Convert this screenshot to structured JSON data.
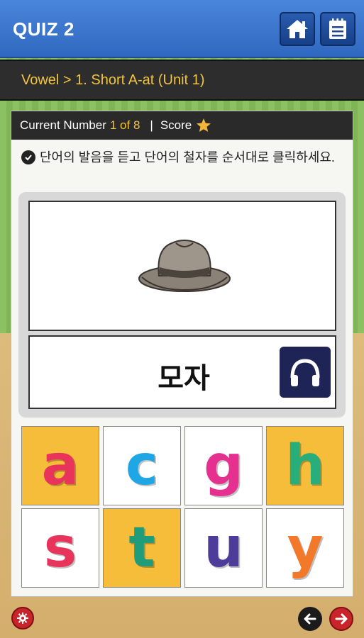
{
  "header": {
    "title": "QUIZ 2",
    "home_icon": "home-icon",
    "list_icon": "notepad-icon"
  },
  "breadcrumb": {
    "text": "Vowel > 1. Short A-at (Unit 1)"
  },
  "status": {
    "current_label": "Current Number",
    "current_value": "1 of 8",
    "separator": "|",
    "score_label": "Score",
    "score_icon": "star-icon"
  },
  "instruction": {
    "text": "단어의 발음을 듣고 단어의 철자를 순서대로 클릭하세요."
  },
  "card": {
    "image": "hat-image",
    "word": "모자",
    "audio_icon": "headphones-icon"
  },
  "letters": [
    {
      "char": "a",
      "color": "#e8345a",
      "bg": "yellow"
    },
    {
      "char": "c",
      "color": "#1ea7e4",
      "bg": "white"
    },
    {
      "char": "g",
      "color": "#e6308f",
      "bg": "white"
    },
    {
      "char": "h",
      "color": "#27ae7a",
      "bg": "yellow"
    },
    {
      "char": "s",
      "color": "#e8345a",
      "bg": "white"
    },
    {
      "char": "t",
      "color": "#1f9c7a",
      "bg": "yellow"
    },
    {
      "char": "u",
      "color": "#4d3c9a",
      "bg": "white"
    },
    {
      "char": "y",
      "color": "#f2792a",
      "bg": "white"
    }
  ],
  "footer": {
    "settings_icon": "gear-icon",
    "prev_icon": "arrow-left-icon",
    "next_icon": "arrow-right-icon"
  }
}
